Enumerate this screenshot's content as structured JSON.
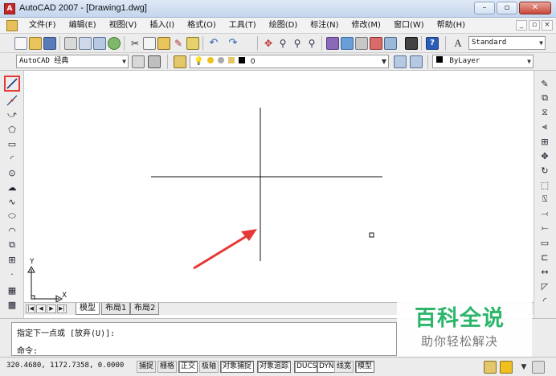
{
  "app": {
    "title": "AutoCAD 2007 - [Drawing1.dwg]"
  },
  "window_controls": {
    "minimize": "–",
    "restore": "▫",
    "close": "✕"
  },
  "mdi_controls": {
    "minimize": "_",
    "restore": "▫",
    "close": "×"
  },
  "menu": [
    {
      "label": "文件(F)"
    },
    {
      "label": "编辑(E)"
    },
    {
      "label": "视图(V)"
    },
    {
      "label": "插入(I)"
    },
    {
      "label": "格式(O)"
    },
    {
      "label": "工具(T)"
    },
    {
      "label": "绘图(D)"
    },
    {
      "label": "标注(N)"
    },
    {
      "label": "修改(M)"
    },
    {
      "label": "窗口(W)"
    },
    {
      "label": "帮助(H)"
    }
  ],
  "toolbar": {
    "text_style": "Standard",
    "workspace": "AutoCAD 经典",
    "layer": "0",
    "color": "ByLayer"
  },
  "ucs": {
    "y": "Y",
    "x": "X"
  },
  "tabs": [
    {
      "label": "模型"
    },
    {
      "label": "布局1"
    },
    {
      "label": "布局2"
    }
  ],
  "command": {
    "history": "指定下一点或 [放弃(U)]:",
    "prompt": "命令:"
  },
  "status": {
    "coords": "320.4680, 1172.7358, 0.0000",
    "toggles": [
      {
        "label": "捕捉",
        "on": false
      },
      {
        "label": "栅格",
        "on": false
      },
      {
        "label": "正交",
        "on": true
      },
      {
        "label": "极轴",
        "on": false
      },
      {
        "label": "对象捕捉",
        "on": true
      },
      {
        "label": "对象追踪",
        "on": true
      },
      {
        "label": "DUCS",
        "on": true
      },
      {
        "label": "DYN",
        "on": true
      },
      {
        "label": "线宽",
        "on": false
      },
      {
        "label": "模型",
        "on": true
      }
    ]
  },
  "watermark": {
    "title": "百科全说",
    "subtitle": "助你轻松解决"
  },
  "colors": {
    "selected_tool_border": "#e53935",
    "arrow": "#e53935",
    "watermark_green": "#2bb66b"
  }
}
